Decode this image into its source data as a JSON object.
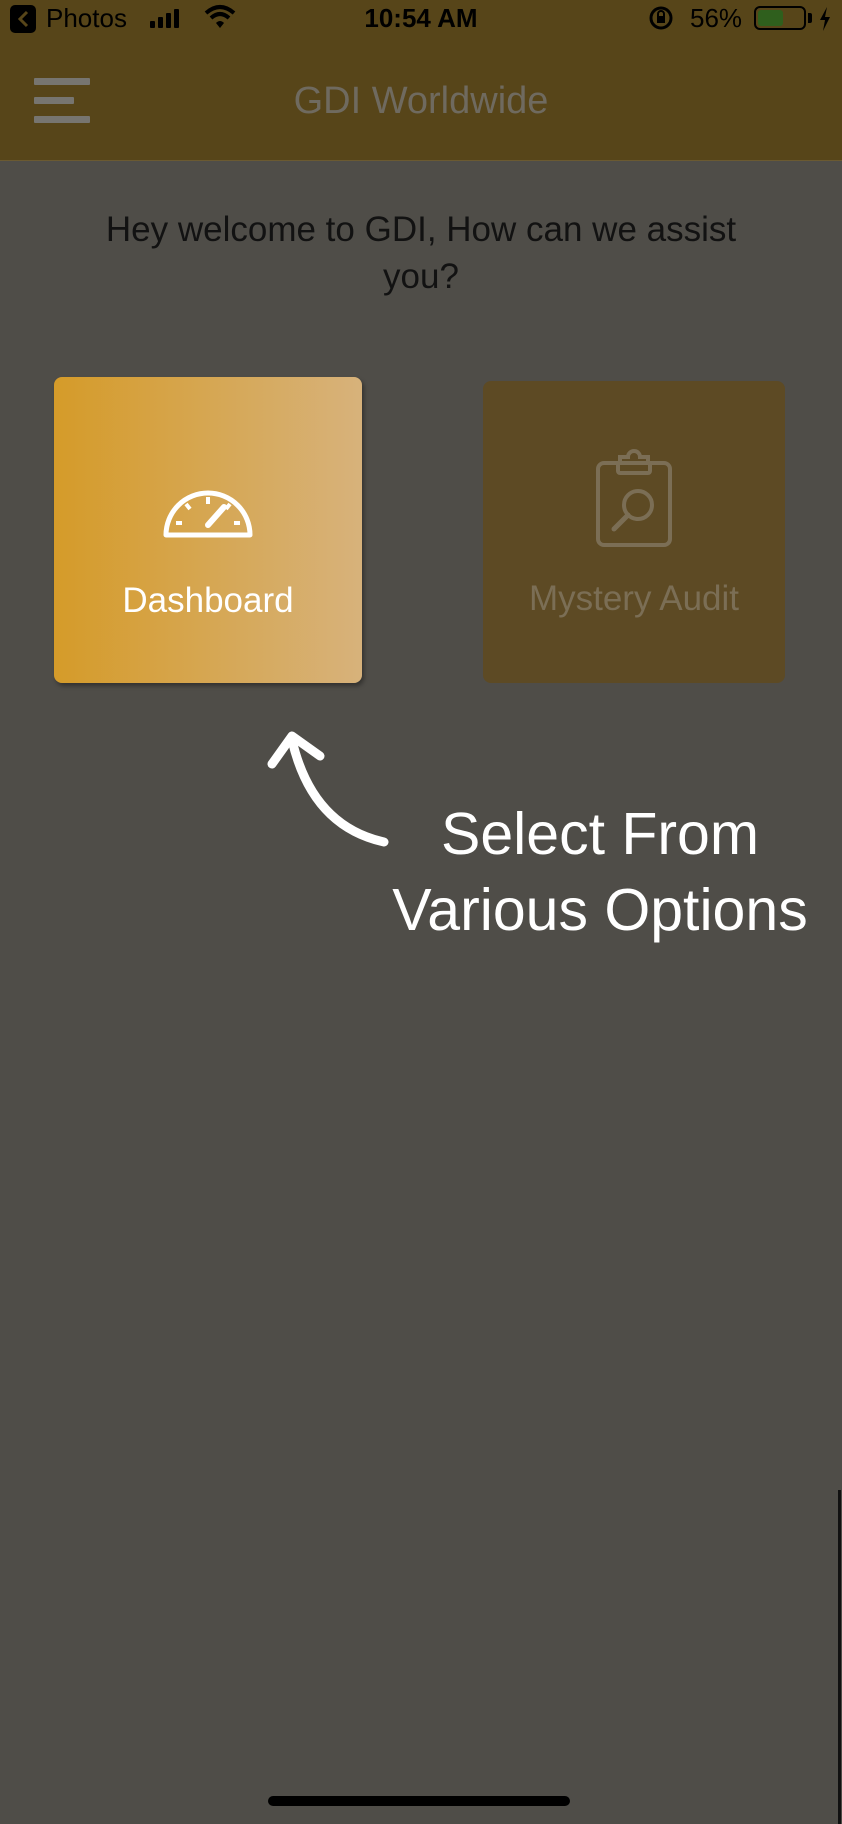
{
  "status_bar": {
    "back_app": "Photos",
    "time": "10:54 AM",
    "battery_percent": "56%",
    "battery_level": 0.56
  },
  "header": {
    "title": "GDI Worldwide",
    "menu_icon": "hamburger-menu-icon"
  },
  "welcome": {
    "text": "Hey welcome to GDI, How can we assist you?"
  },
  "tiles": [
    {
      "label": "Dashboard",
      "icon": "speedometer-icon"
    },
    {
      "label": "Mystery Audit",
      "icon": "clipboard-search-icon"
    }
  ],
  "annotation": {
    "line1": "Select From",
    "line2": "Various Options",
    "icon": "curved-arrow-icon"
  },
  "colors": {
    "header_bg": "#574519",
    "overlay_bg": "#4f4d48",
    "dashboard_gradient_start": "#d59b29",
    "dashboard_gradient_end": "#d7b27b",
    "audit_tile_bg": "#5d4a24"
  }
}
